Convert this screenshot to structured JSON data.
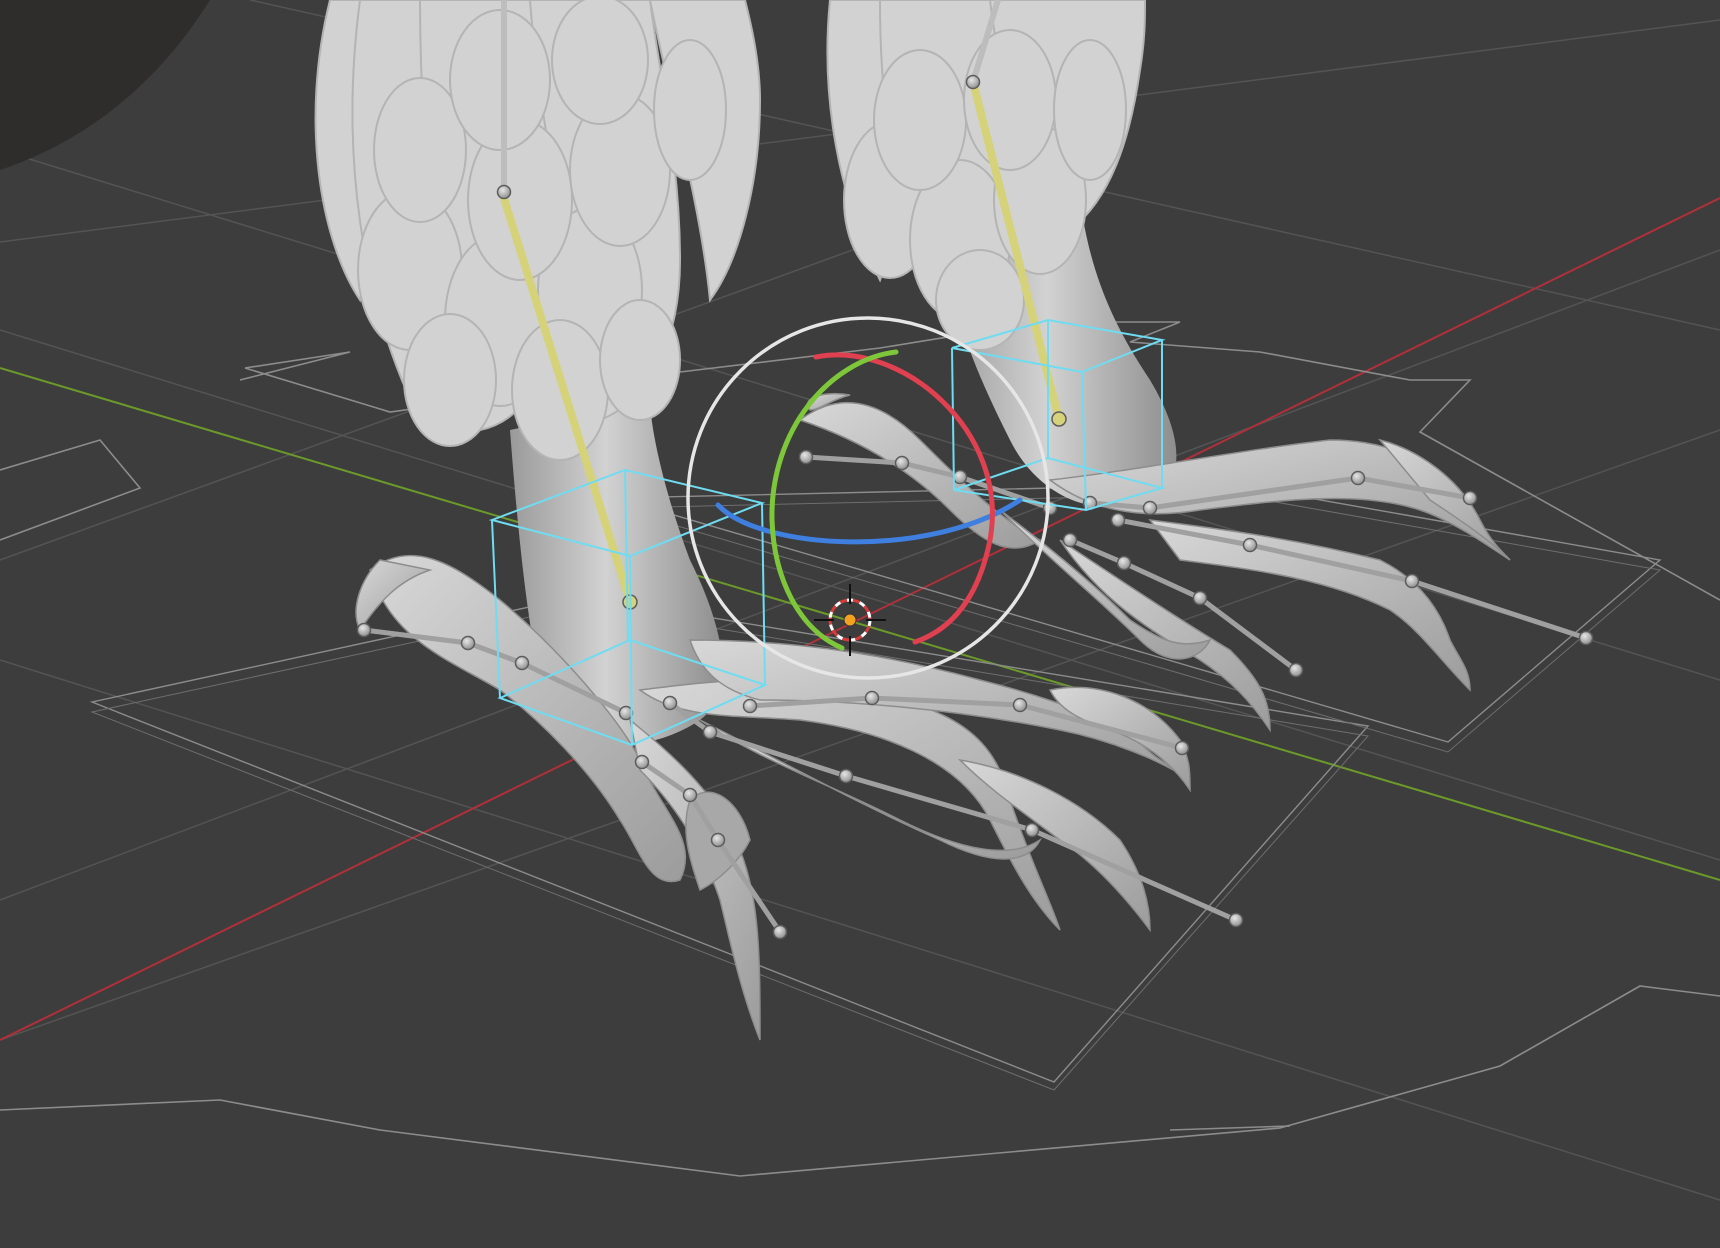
{
  "viewport": {
    "mode": "3d-viewport-pose",
    "background_color": "#3d3d3d",
    "grid_line_color": "#545454",
    "x_axis_color": "#b0303a",
    "y_axis_color": "#6c9a2a",
    "outline_color": "#9a9a9a"
  },
  "mesh": {
    "color": "#c8c8c8",
    "shade_color": "#a3a3a3",
    "feather_color": "#d4d4d4"
  },
  "armature": {
    "bone_color": "#9e9e9e",
    "selected_bone_color": "#d6d27a",
    "joint_count": 30
  },
  "controls": {
    "ik_cube_color": "#6fdcf2",
    "icons": [
      "ik-control-cube-left",
      "ik-control-cube-right"
    ]
  },
  "gizmo": {
    "type": "rotate",
    "ring_color": "#e6e6e6",
    "x_color": "#e04050",
    "y_color": "#7ec73a",
    "z_color": "#3f7fe0",
    "pivot_color": "#f4a020"
  },
  "cursor": {
    "icon": "3d-cursor-icon",
    "primary_color": "#d93a3a",
    "secondary_color": "#ffffff"
  }
}
